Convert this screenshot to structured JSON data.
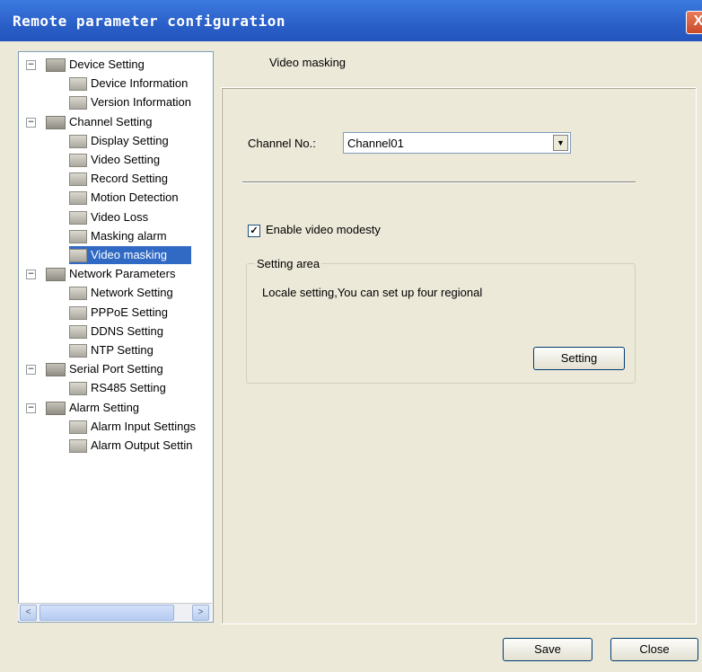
{
  "window": {
    "title": "Remote parameter configuration",
    "close_glyph": "X"
  },
  "tree": {
    "nodes": [
      {
        "label": "Device Setting",
        "level": 0,
        "expanded": true
      },
      {
        "label": "Device Information",
        "level": 1
      },
      {
        "label": "Version Information",
        "level": 1
      },
      {
        "label": "Channel Setting",
        "level": 0,
        "expanded": true
      },
      {
        "label": "Display Setting",
        "level": 1
      },
      {
        "label": "Video Setting",
        "level": 1
      },
      {
        "label": "Record Setting",
        "level": 1
      },
      {
        "label": "Motion Detection",
        "level": 1
      },
      {
        "label": "Video Loss",
        "level": 1
      },
      {
        "label": "Masking alarm",
        "level": 1
      },
      {
        "label": "Video masking",
        "level": 1,
        "selected": true
      },
      {
        "label": "Network Parameters",
        "level": 0,
        "expanded": true
      },
      {
        "label": "Network Setting",
        "level": 1
      },
      {
        "label": "PPPoE Setting",
        "level": 1
      },
      {
        "label": "DDNS Setting",
        "level": 1
      },
      {
        "label": "NTP Setting",
        "level": 1
      },
      {
        "label": "Serial Port Setting",
        "level": 0,
        "expanded": true
      },
      {
        "label": "RS485 Setting",
        "level": 1
      },
      {
        "label": "Alarm Setting",
        "level": 0,
        "expanded": true
      },
      {
        "label": "Alarm Input Settings",
        "level": 1
      },
      {
        "label": "Alarm Output Settin",
        "level": 1
      }
    ],
    "scroll_left": "<",
    "scroll_right": ">"
  },
  "panel": {
    "title": "Video masking",
    "channel_label": "Channel No.:",
    "channel_value": "Channel01",
    "enable_checked": true,
    "enable_label": "Enable video modesty",
    "group_title": "Setting area",
    "group_text": "Locale setting,You can set up four regional",
    "setting_button": "Setting"
  },
  "footer": {
    "save_button": "Save",
    "close_button": "Close"
  },
  "colors": {
    "titlebar": "#2a5fc8",
    "selection": "#316ac5",
    "window_bg": "#ece9d8"
  }
}
